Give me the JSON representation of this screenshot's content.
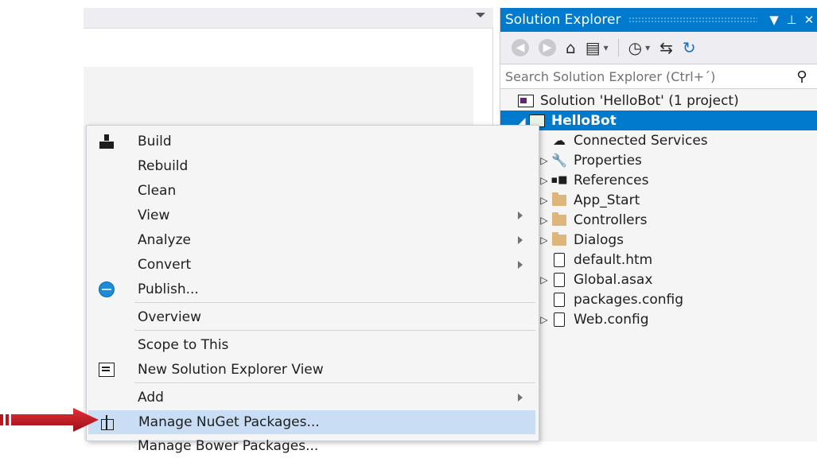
{
  "solution_explorer": {
    "title": "Solution Explorer",
    "title_buttons": {
      "dropdown": "▼",
      "pin": "⊥",
      "close": "✕"
    },
    "search_placeholder": "Search Solution Explorer (Ctrl+´)",
    "tree": [
      {
        "label": "Solution 'HelloBot' (1 project)",
        "icon": "solution-icon",
        "level": 0,
        "expander": "",
        "selected": false
      },
      {
        "label": "HelloBot",
        "icon": "project-icon",
        "level": 0,
        "expander": "◢",
        "selected": true
      },
      {
        "label": "Connected Services",
        "icon": "connected-services-icon",
        "level": 1,
        "expander": "",
        "selected": false
      },
      {
        "label": "Properties",
        "icon": "wrench-icon",
        "level": 1,
        "expander": "▷",
        "selected": false
      },
      {
        "label": "References",
        "icon": "references-icon",
        "level": 1,
        "expander": "▷",
        "selected": false
      },
      {
        "label": "App_Start",
        "icon": "folder-icon",
        "level": 1,
        "expander": "▷",
        "selected": false
      },
      {
        "label": "Controllers",
        "icon": "folder-icon",
        "level": 1,
        "expander": "▷",
        "selected": false
      },
      {
        "label": "Dialogs",
        "icon": "folder-icon",
        "level": 1,
        "expander": "▷",
        "selected": false
      },
      {
        "label": "default.htm",
        "icon": "html-file-icon",
        "level": 1,
        "expander": "",
        "selected": false
      },
      {
        "label": "Global.asax",
        "icon": "asax-file-icon",
        "level": 1,
        "expander": "▷",
        "selected": false
      },
      {
        "label": "packages.config",
        "icon": "config-file-icon",
        "level": 1,
        "expander": "",
        "selected": false
      },
      {
        "label": "Web.config",
        "icon": "config-file-icon",
        "level": 1,
        "expander": "▷",
        "selected": false
      }
    ]
  },
  "context_menu": {
    "items": [
      {
        "label": "Build",
        "icon": "build-icon",
        "submenu": false,
        "highlighted": false
      },
      {
        "label": "Rebuild",
        "icon": "",
        "submenu": false,
        "highlighted": false
      },
      {
        "label": "Clean",
        "icon": "",
        "submenu": false,
        "highlighted": false
      },
      {
        "label": "View",
        "icon": "",
        "submenu": true,
        "highlighted": false
      },
      {
        "label": "Analyze",
        "icon": "",
        "submenu": true,
        "highlighted": false
      },
      {
        "label": "Convert",
        "icon": "",
        "submenu": true,
        "highlighted": false
      },
      {
        "label": "Publish...",
        "icon": "publish-globe-icon",
        "submenu": false,
        "highlighted": false
      },
      {
        "label": "Overview",
        "icon": "",
        "submenu": false,
        "highlighted": false
      },
      {
        "label": "Scope to This",
        "icon": "",
        "submenu": false,
        "highlighted": false
      },
      {
        "label": "New Solution Explorer View",
        "icon": "new-view-icon",
        "submenu": false,
        "highlighted": false
      },
      {
        "label": "Add",
        "icon": "",
        "submenu": true,
        "highlighted": false
      },
      {
        "label": "Manage NuGet Packages...",
        "icon": "nuget-icon",
        "submenu": false,
        "highlighted": true
      },
      {
        "label": "Manage Bower Packages...",
        "icon": "",
        "submenu": false,
        "highlighted": false
      }
    ]
  },
  "colors": {
    "accent": "#007acc",
    "menu_highlight": "#c9def5",
    "annotation_arrow": "#c0141c"
  }
}
